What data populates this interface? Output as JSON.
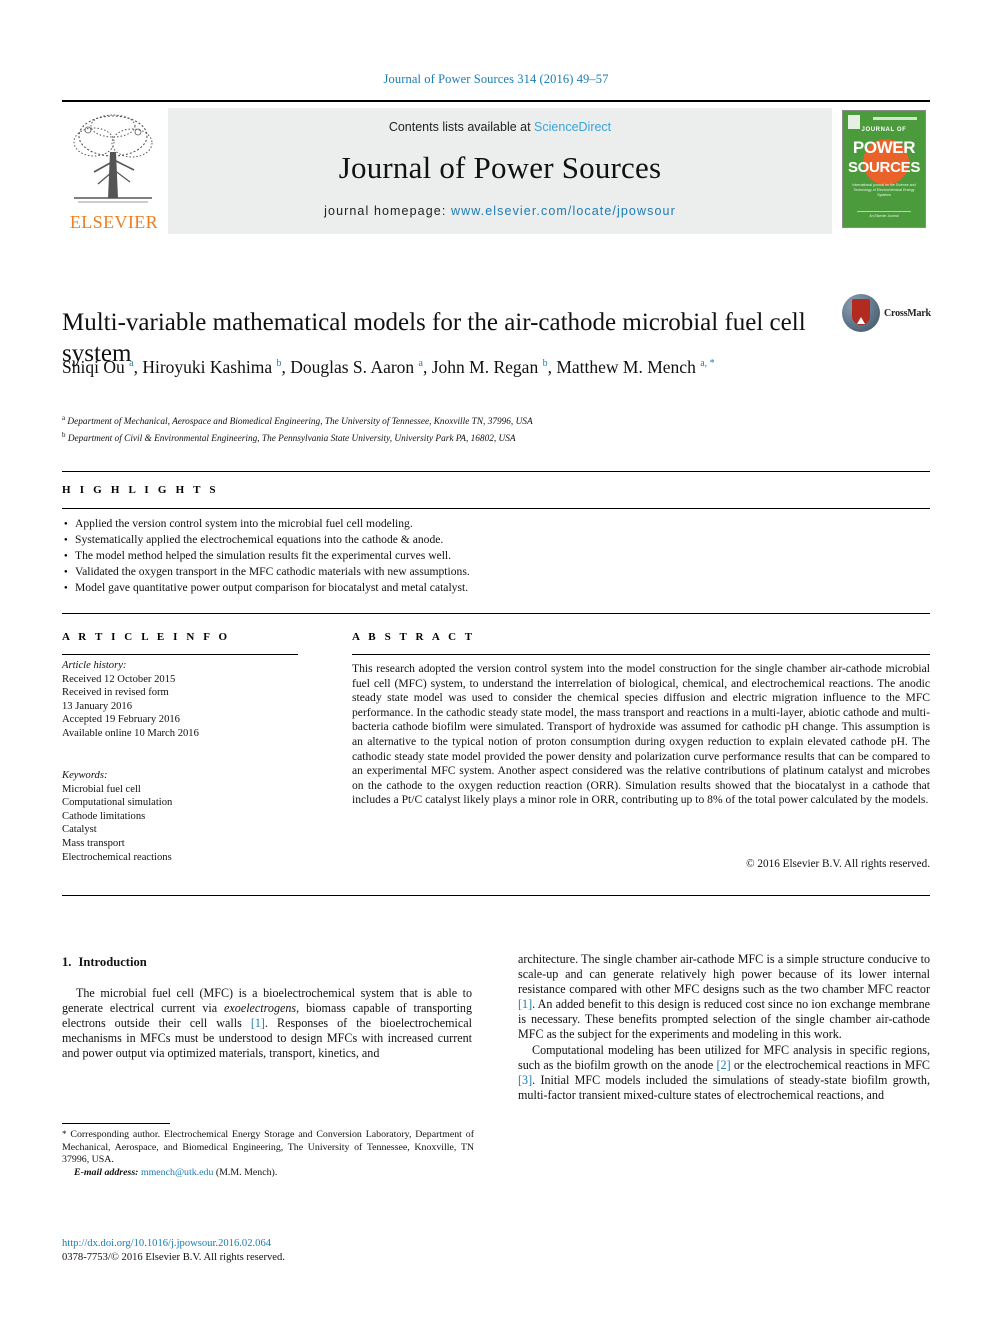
{
  "running_head": "Journal of Power Sources 314 (2016) 49–57",
  "masthead": {
    "publisher": "ELSEVIER",
    "contents_prefix": "Contents lists available at ",
    "contents_link": "ScienceDirect",
    "journal_name": "Journal of Power Sources",
    "homepage_prefix": "journal homepage: ",
    "homepage_url": "www.elsevier.com/locate/jpowsour",
    "cover": {
      "kicker": "JOURNAL OF",
      "word1": "POWER",
      "word2": "SOURCES",
      "subtitle": "International journal on the Science and Technology of Electrochemical Energy Systems",
      "footer": "An Elsevier Journal"
    }
  },
  "article": {
    "title": "Multi-variable mathematical models for the air-cathode microbial fuel cell system",
    "crossmark_label": "CrossMark",
    "authors": [
      {
        "name": "Shiqi Ou",
        "marks": "a",
        "sep": ", "
      },
      {
        "name": "Hiroyuki Kashima",
        "marks": "b",
        "sep": ", "
      },
      {
        "name": "Douglas S. Aaron",
        "marks": "a",
        "sep": ", "
      },
      {
        "name": "John M. Regan",
        "marks": "b",
        "sep": ", "
      },
      {
        "name": "Matthew M. Mench",
        "marks": "a, *",
        "sep": ""
      }
    ],
    "affiliations": [
      {
        "mark": "a",
        "text": "Department of Mechanical, Aerospace and Biomedical Engineering, The University of Tennessee, Knoxville TN, 37996, USA"
      },
      {
        "mark": "b",
        "text": "Department of Civil & Environmental Engineering, The Pennsylvania State University, University Park PA, 16802, USA"
      }
    ]
  },
  "highlights": {
    "heading": "H I G H L I G H T S",
    "items": [
      "Applied the version control system into the microbial fuel cell modeling.",
      "Systematically applied the electrochemical equations into the cathode & anode.",
      "The model method helped the simulation results fit the experimental curves well.",
      "Validated the oxygen transport in the MFC cathodic materials with new assumptions.",
      "Model gave quantitative power output comparison for biocatalyst and metal catalyst."
    ]
  },
  "article_info": {
    "heading": "A R T I C L E   I N F O",
    "history_label": "Article history:",
    "history": [
      "Received 12 October 2015",
      "Received in revised form",
      "13 January 2016",
      "Accepted 19 February 2016",
      "Available online 10 March 2016"
    ],
    "keywords_label": "Keywords:",
    "keywords": [
      "Microbial fuel cell",
      "Computational simulation",
      "Cathode limitations",
      "Catalyst",
      "Mass transport",
      "Electrochemical reactions"
    ]
  },
  "abstract": {
    "heading": "A B S T R A C T",
    "text": "This research adopted the version control system into the model construction for the single chamber air-cathode microbial fuel cell (MFC) system, to understand the interrelation of biological, chemical, and electrochemical reactions. The anodic steady state model was used to consider the chemical species diffusion and electric migration influence to the MFC performance. In the cathodic steady state model, the mass transport and reactions in a multi-layer, abiotic cathode and multi-bacteria cathode biofilm were simulated. Transport of hydroxide was assumed for cathodic pH change. This assumption is an alternative to the typical notion of proton consumption during oxygen reduction to explain elevated cathode pH. The cathodic steady state model provided the power density and polarization curve performance results that can be compared to an experimental MFC system. Another aspect considered was the relative contributions of platinum catalyst and microbes on the cathode to the oxygen reduction reaction (ORR). Simulation results showed that the biocatalyst in a cathode that includes a Pt/C catalyst likely plays a minor role in ORR, contributing up to 8% of the total power calculated by the models.",
    "copyright": "© 2016 Elsevier B.V. All rights reserved."
  },
  "body": {
    "section_number": "1.",
    "section_title": "Introduction",
    "left_paragraph_1_part1": "The microbial fuel cell (MFC) is a bioelectrochemical system that is able to generate electrical current via ",
    "left_paragraph_1_italic": "exoelectrogens",
    "left_paragraph_1_part2": ", biomass capable of transporting electrons outside their cell walls ",
    "left_paragraph_1_cite": "[1]",
    "left_paragraph_1_part3": ". Responses of the bioelectrochemical mechanisms in MFCs must be understood to design MFCs with increased current and power output via optimized materials, transport, kinetics, and",
    "right_paragraph_1_part1": "architecture. The single chamber air-cathode MFC is a simple structure conducive to scale-up and can generate relatively high power because of its lower internal resistance compared with other MFC designs such as the two chamber MFC reactor ",
    "right_paragraph_1_cite": "[1]",
    "right_paragraph_1_part2": ". An added benefit to this design is reduced cost since no ion exchange membrane is necessary. These benefits prompted selection of the single chamber air-cathode MFC as the subject for the experiments and modeling in this work.",
    "right_paragraph_2_part1": "Computational modeling has been utilized for MFC analysis in specific regions, such as the biofilm growth on the anode ",
    "right_paragraph_2_cite1": "[2]",
    "right_paragraph_2_part2": " or the electrochemical reactions in MFC ",
    "right_paragraph_2_cite2": "[3]",
    "right_paragraph_2_part3": ". Initial MFC models included the simulations of steady-state biofilm growth, multi-factor transient mixed-culture states of electrochemical reactions, and"
  },
  "footnote": {
    "star": "*",
    "text": " Corresponding author. Electrochemical Energy Storage and Conversion Laboratory, Department of Mechanical, Aerospace, and Biomedical Engineering, The University of Tennessee, Knoxville, TN 37996, USA.",
    "email_label": "E-mail address:",
    "email": "mmench@utk.edu",
    "email_suffix": " (M.M. Mench)."
  },
  "footer": {
    "doi": "http://dx.doi.org/10.1016/j.jpowsour.2016.02.064",
    "issn_line": "0378-7753/© 2016 Elsevier B.V. All rights reserved."
  },
  "colors": {
    "link_blue": "#1a7cb5",
    "elsevier_orange": "#ed7d23",
    "cover_green": "#4b9a3c",
    "cover_orange": "#e8622a"
  }
}
